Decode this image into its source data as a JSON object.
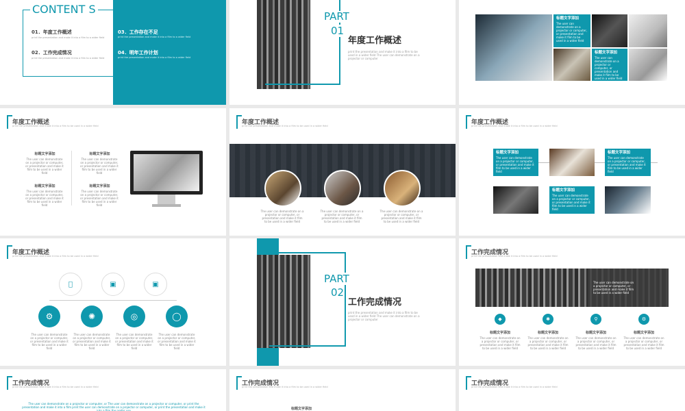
{
  "contents": {
    "heading": "CONTENT S",
    "items": [
      {
        "num": "01．",
        "label": "年度工作概述",
        "desc": "print the presentation and make it into a film to a wider field"
      },
      {
        "num": "02．",
        "label": "工作完成情况",
        "desc": "print the presentation and make it into a film to a wider field"
      },
      {
        "num": "03．",
        "label": "工作存在不足",
        "desc": "print the presentation and make it into a film to a wider field"
      },
      {
        "num": "04．",
        "label": "明年工作计划",
        "desc": "print the presentation and make it into a film to a wider field"
      }
    ]
  },
  "part1": {
    "part": "PART",
    "num": "01",
    "title": "年度工作概述",
    "desc": "print the presentation and make it into a film to be used in a wider field The user can demonstrate on a projector or computer"
  },
  "part2": {
    "part": "PART",
    "num": "02",
    "title": "工作完成情况",
    "desc": "print the presentation and make it into a film to be used in a wider field The user can demonstrate on a projector or computer"
  },
  "section_titles": {
    "s1": "年度工作概述",
    "s2": "工作完成情况"
  },
  "subtitle": "print the presentation and make it into a film to be used in a wider field",
  "card_title": "标题文字添加",
  "card_desc": "The user can demonstrate on a projector or computer, or presentation and make it film to be used in a wider field",
  "short_desc": "The user can demonstrate on a projector or computer, or presentation and make it film to be used in a wider field",
  "long_text": "The user can demonstrate on a projector or computer, or The user can demonstrate on a projector or computer, or print the presentation and make it into a film print the user can demonstrate on a projector or computer, or print the presentation and make it into a film the prefer use",
  "colors": {
    "accent": "#0f98ad"
  },
  "icons": [
    "apple-icon",
    "instagram-icon",
    "lock-icon",
    "gear-icon",
    "aperture-icon",
    "target-icon",
    "broadcast-icon"
  ]
}
